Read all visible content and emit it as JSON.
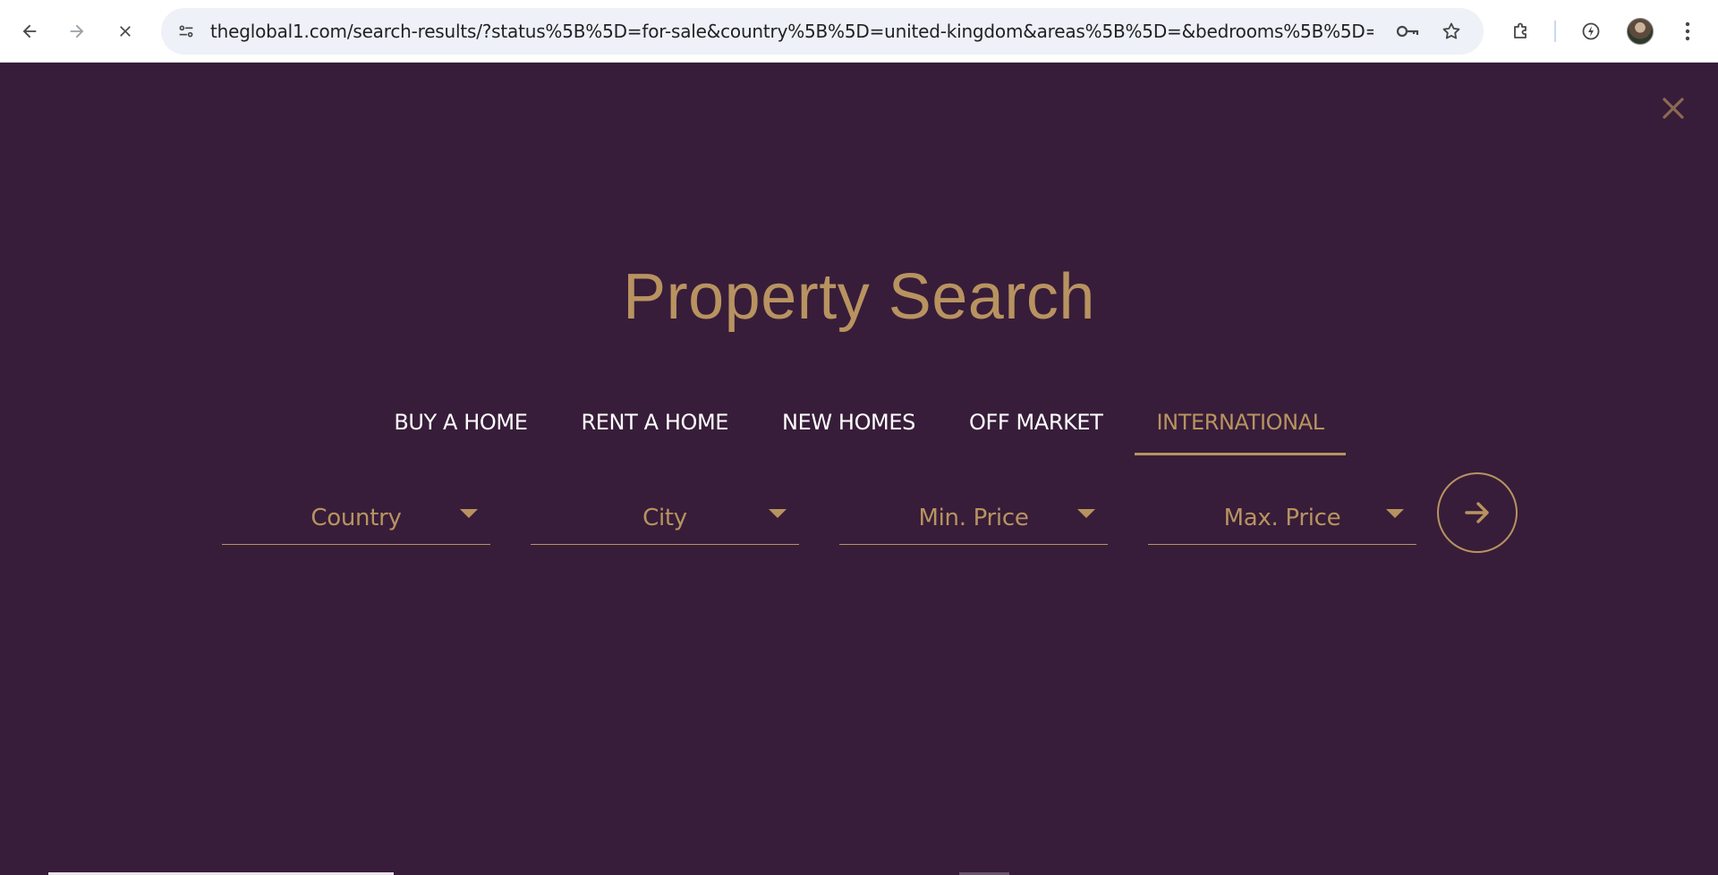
{
  "browser": {
    "url": "theglobal1.com/search-results/?status%5B%5D=for-sale&country%5B%5D=united-kingdom&areas%5B%5D=&bedrooms%5B%5D=&min-...",
    "icons": [
      "back-arrow-icon",
      "forward-arrow-icon",
      "stop-loading-icon",
      "site-info-icon",
      "password-key-icon",
      "bookmark-star-icon",
      "extensions-icon",
      "performance-icon",
      "profile-avatar",
      "more-menu-icon"
    ]
  },
  "search_panel": {
    "title": "Property Search",
    "tabs": [
      {
        "label": "BUY A HOME",
        "active": false
      },
      {
        "label": "RENT A HOME",
        "active": false
      },
      {
        "label": "NEW HOMES",
        "active": false
      },
      {
        "label": "OFF MARKET",
        "active": false
      },
      {
        "label": "INTERNATIONAL",
        "active": true
      }
    ],
    "filters": {
      "country": "Country",
      "city": "City",
      "min_price": "Min. Price",
      "max_price": "Max. Price"
    }
  },
  "colors": {
    "background": "#371d39",
    "accent": "#b89360",
    "text_light": "#ffffff"
  }
}
